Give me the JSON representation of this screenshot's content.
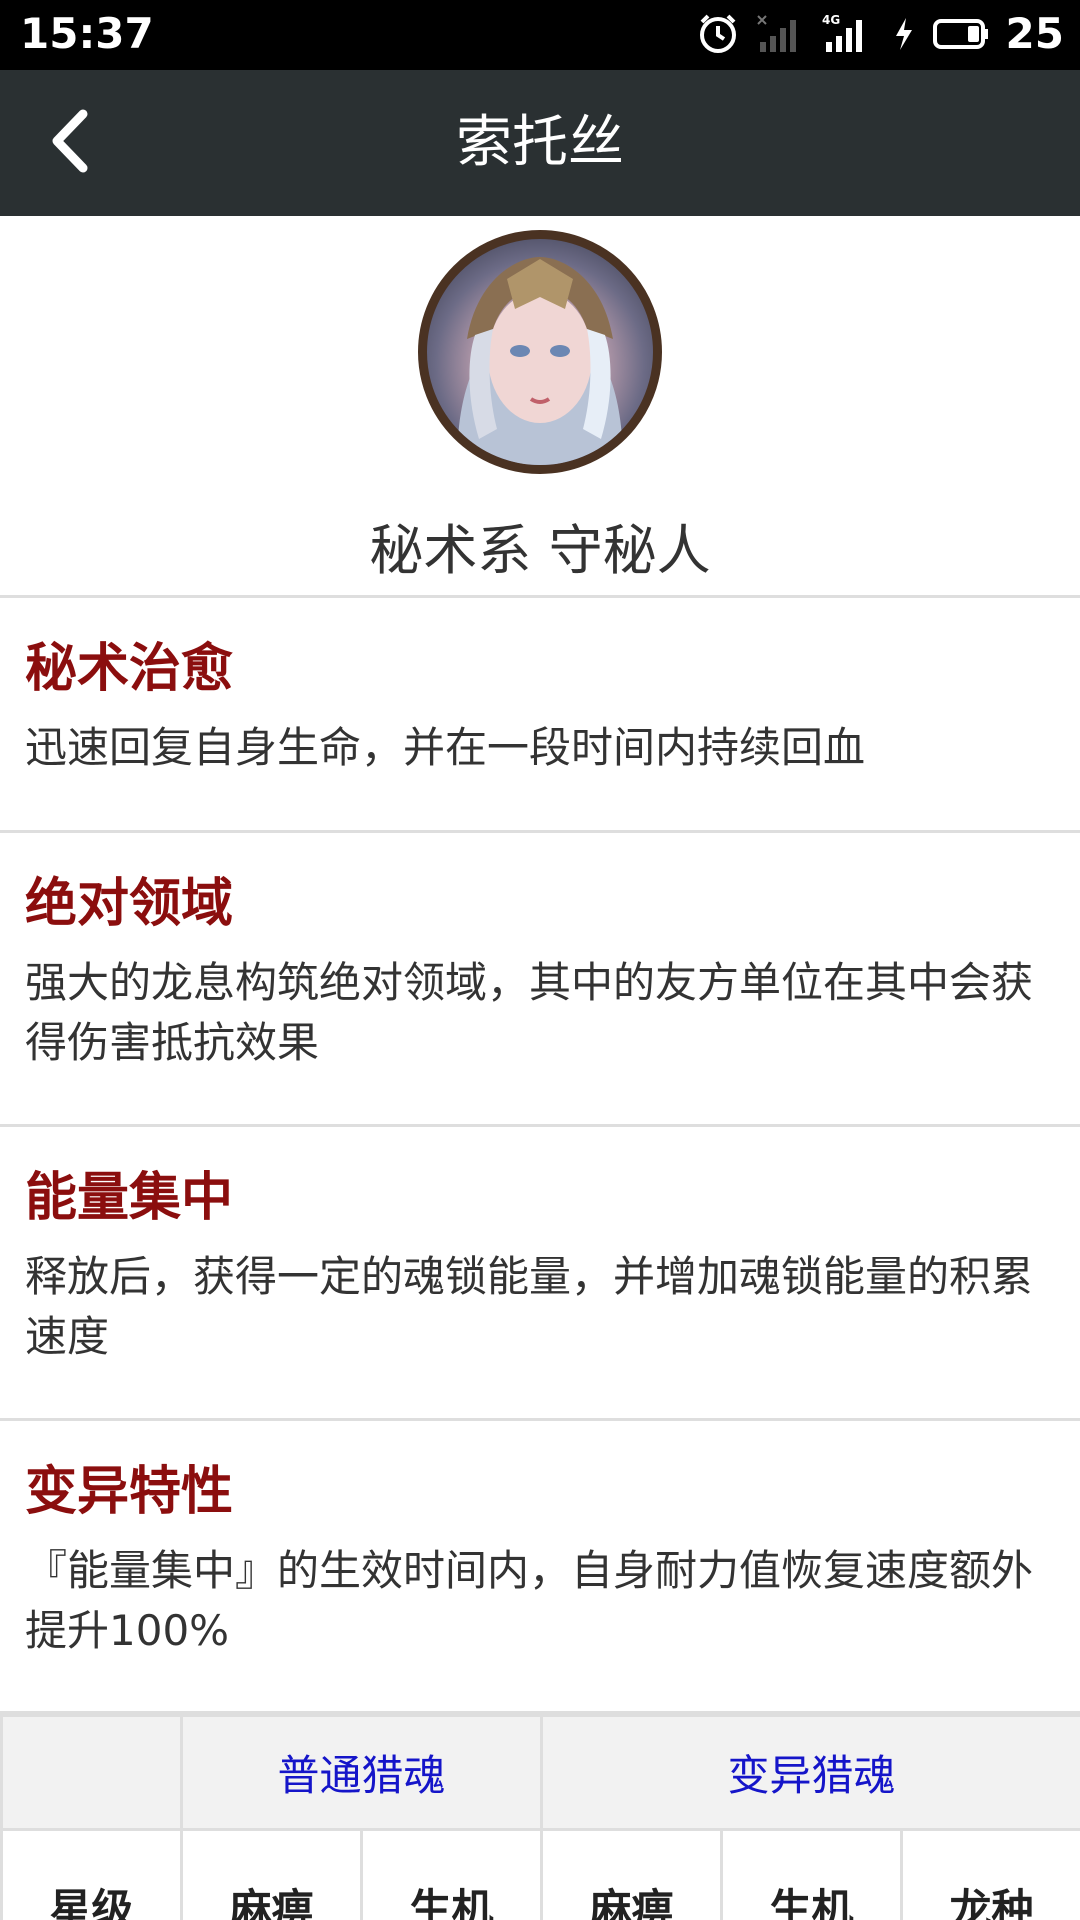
{
  "status_bar": {
    "time": "15:37",
    "network": "4G",
    "battery": "25",
    "icons": [
      "alarm-icon",
      "no-signal-icon",
      "signal-4g-icon",
      "charging-icon",
      "battery-icon"
    ]
  },
  "nav": {
    "title": "索托丝",
    "back_icon": "chevron-left-icon"
  },
  "hero": {
    "avatar": "hero-portrait",
    "subtitle": "秘术系 守秘人"
  },
  "skills": [
    {
      "name": "秘术治愈",
      "desc": "迅速回复自身生命，并在一段时间内持续回血"
    },
    {
      "name": "绝对领域",
      "desc": "强大的龙息构筑绝对领域，其中的友方单位在其中会获得伤害抵抗效果"
    },
    {
      "name": "能量集中",
      "desc": "释放后，获得一定的魂锁能量，并增加魂锁能量的积累速度"
    },
    {
      "name": "变异特性",
      "desc": "『能量集中』的生效时间内，自身耐力值恢复速度额外提升100%"
    }
  ],
  "table": {
    "header": {
      "empty": "",
      "normal": "普通猎魂",
      "mutant": "变异猎魂"
    },
    "columns": [
      "星级",
      "麻痹",
      "生机",
      "麻痹",
      "生机",
      "龙种"
    ]
  },
  "colors": {
    "status_bg": "#000000",
    "nav_bg": "#2a3032",
    "skill_title": "#8b0e0e",
    "link": "#1515c9",
    "divider": "#dedede"
  }
}
